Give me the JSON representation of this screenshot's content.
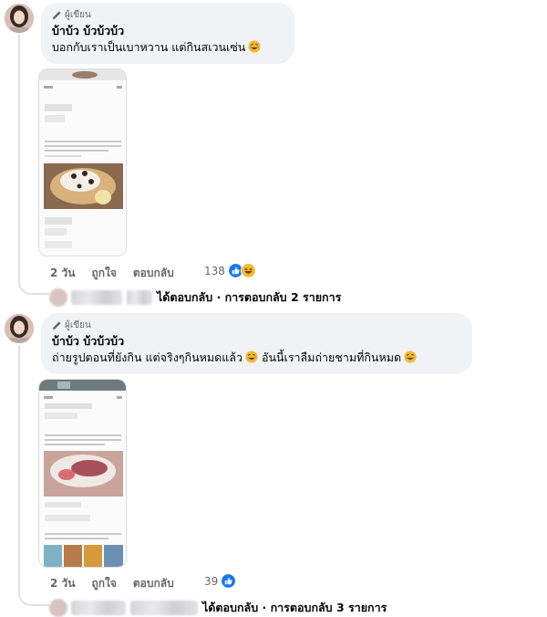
{
  "comments": [
    {
      "author_tag": "ผู้เขียน",
      "author_name": "บ้าบ้ว บ้วบ้วบ้ว",
      "text": "บอกกับเราเป็นเบาหวาน แต่กินสเวนเซ่น",
      "emoji_icon": "rolling-laughing-emoji",
      "actions": {
        "time": "2 วัน",
        "like": "ถูกใจ",
        "reply": "ตอบกลับ"
      },
      "reaction_count": "138",
      "reaction_icons": [
        "like-reaction-icon",
        "haha-reaction-icon"
      ],
      "reply_summary": "ได้ตอบกลับ · การตอบกลับ 2 รายการ"
    },
    {
      "author_tag": "ผู้เขียน",
      "author_name": "บ้าบ้ว บ้วบ้วบ้ว",
      "text_part1": "ถ่ายรูปตอนที่ยังกิน แต่จริงๆกินหมดแล้ว",
      "text_part2": "อันนี้เราลืมถ่ายชามที่กินหมด",
      "emoji_icon": "rolling-laughing-emoji",
      "actions": {
        "time": "2 วัน",
        "like": "ถูกใจ",
        "reply": "ตอบกลับ"
      },
      "reaction_count": "39",
      "reaction_icons": [
        "like-reaction-icon"
      ],
      "reply_summary": "ได้ตอบกลับ · การตอบกลับ 3 รายการ"
    }
  ],
  "colors": {
    "bubble": "#f0f2f5",
    "like_blue": "#1877f2",
    "haha_yellow": "#f7b928",
    "meta_gray": "#65676b"
  }
}
